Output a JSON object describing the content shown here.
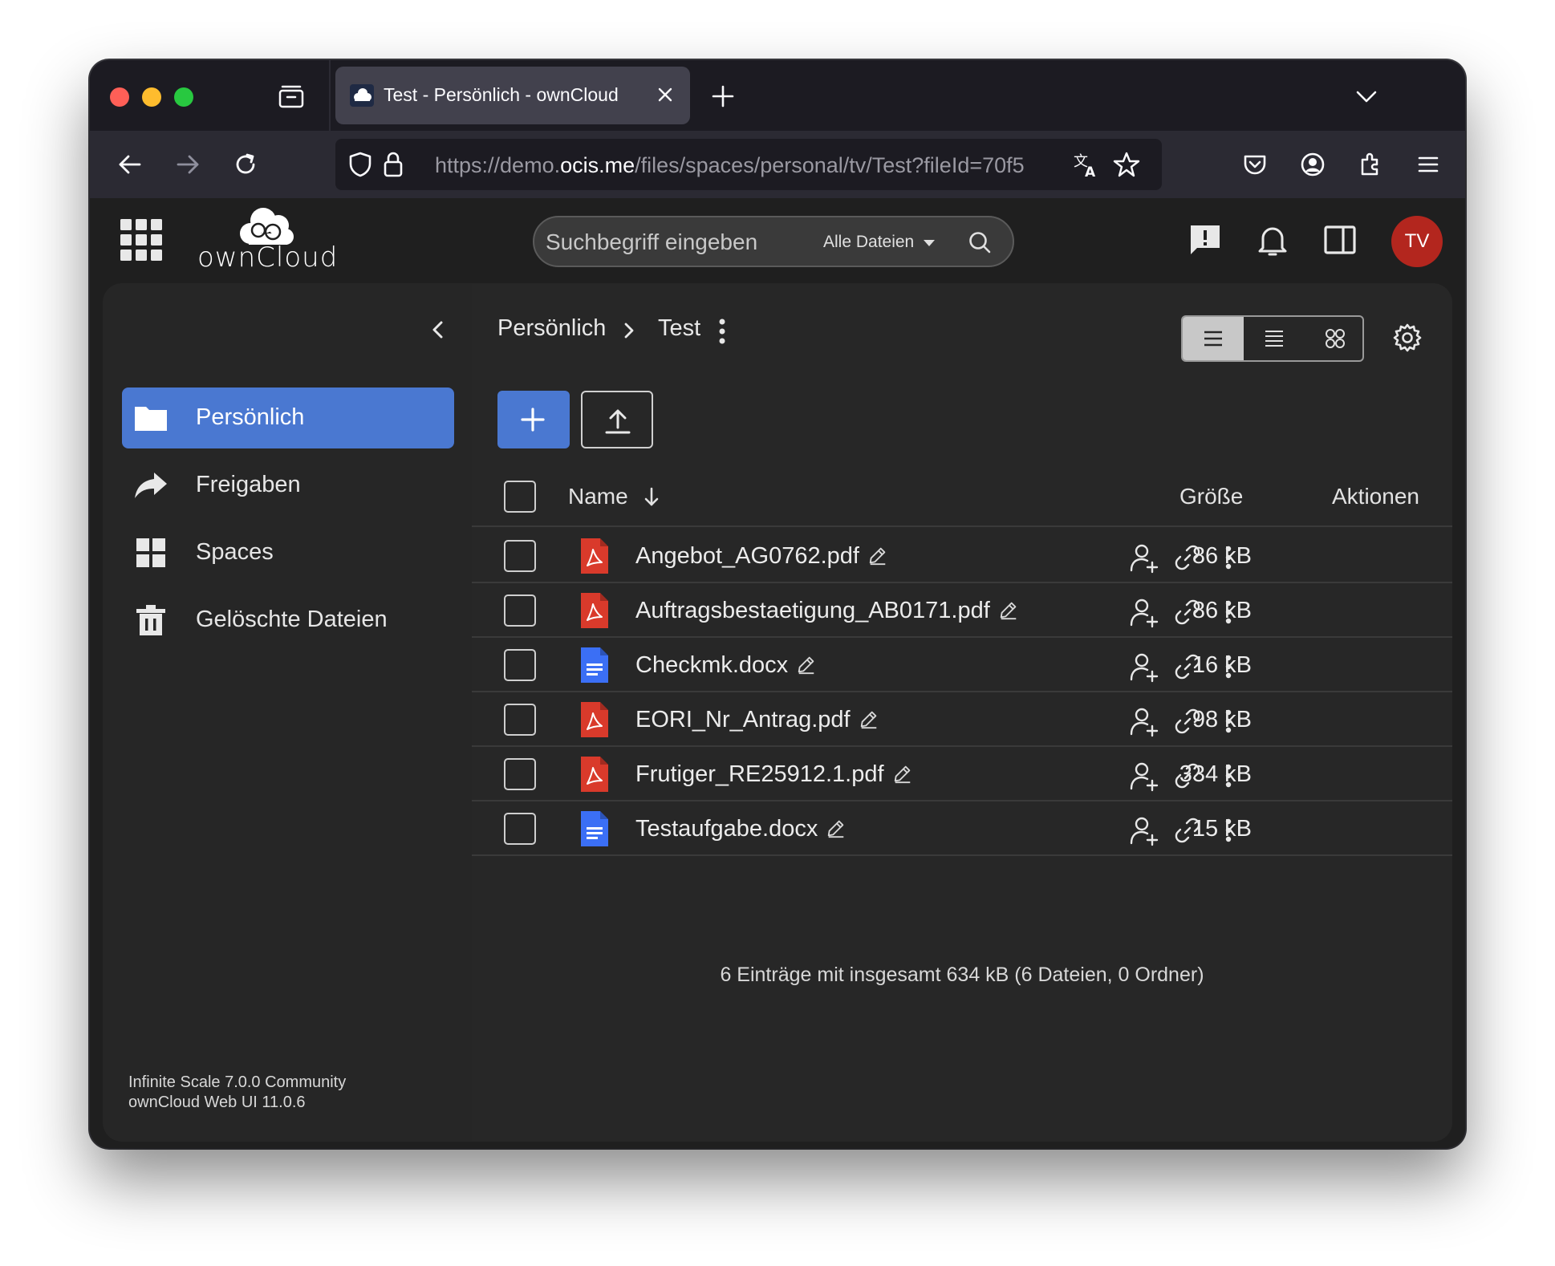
{
  "browser": {
    "tab_title": "Test - Persönlich - ownCloud",
    "url_prefix": "https://demo.",
    "url_host": "ocis.me",
    "url_suffix": "/files/spaces/personal/tv/Test?fileId=70f5"
  },
  "header": {
    "logo_text": "ownCloud",
    "search_placeholder": "Suchbegriff eingeben",
    "search_scope": "Alle Dateien",
    "avatar_initials": "TV"
  },
  "sidebar": {
    "items": [
      {
        "label": "Persönlich",
        "icon": "folder-icon",
        "active": true
      },
      {
        "label": "Freigaben",
        "icon": "share-icon",
        "active": false
      },
      {
        "label": "Spaces",
        "icon": "spaces-grid-icon",
        "active": false
      },
      {
        "label": "Gelöschte Dateien",
        "icon": "trash-icon",
        "active": false
      }
    ],
    "version_line1": "Infinite Scale 7.0.0 Community",
    "version_line2": "ownCloud Web UI 11.0.6"
  },
  "breadcrumb": {
    "root": "Persönlich",
    "current": "Test"
  },
  "table": {
    "col_name": "Name",
    "col_size": "Größe",
    "col_actions": "Aktionen",
    "rows": [
      {
        "name": "Angebot_AG0762.pdf",
        "size": "86 kB",
        "type": "pdf"
      },
      {
        "name": "Auftragsbestaetigung_AB0171.pdf",
        "size": "86 kB",
        "type": "pdf"
      },
      {
        "name": "Checkmk.docx",
        "size": "16 kB",
        "type": "docx"
      },
      {
        "name": "EORI_Nr_Antrag.pdf",
        "size": "98 kB",
        "type": "pdf"
      },
      {
        "name": "Frutiger_RE25912.1.pdf",
        "size": "334 kB",
        "type": "pdf"
      },
      {
        "name": "Testaufgabe.docx",
        "size": "15 kB",
        "type": "docx"
      }
    ]
  },
  "summary": "6 Einträge mit insgesamt 634 kB (6 Dateien, 0 Ordner)",
  "colors": {
    "accent": "#4a78d1",
    "pdf": "#d93a2b",
    "docx": "#3b6ff5",
    "avatar": "#b3261e"
  }
}
